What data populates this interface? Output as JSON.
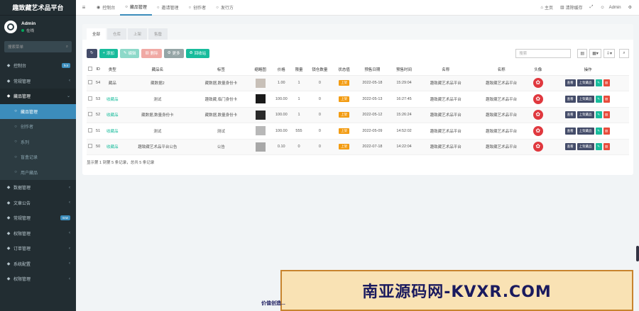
{
  "brand": "趣致藏艺术品平台",
  "user": {
    "name": "Admin",
    "status": "在线"
  },
  "sidebar_search_placeholder": "搜索菜单",
  "sidebar": [
    {
      "label": "控制台",
      "icon": "dashboard-icon",
      "badge": "hot",
      "badge_color": "#3c8dbc"
    },
    {
      "label": "常规管理",
      "icon": "cog-icon",
      "chev": "‹"
    },
    {
      "label": "藏品管理",
      "icon": "cube-icon",
      "chev": "⌄",
      "state": "open"
    },
    {
      "label": "藏品管理",
      "state": "active",
      "sub": true
    },
    {
      "label": "创作者",
      "sub": true
    },
    {
      "label": "系列",
      "sub": true
    },
    {
      "label": "盲盒记录",
      "sub": true
    },
    {
      "label": "用户藏品",
      "sub": true
    },
    {
      "label": "数据管理",
      "icon": "chart-icon",
      "chev": "‹"
    },
    {
      "label": "文章公告",
      "icon": "file-icon",
      "chev": "‹"
    },
    {
      "label": "常规管理",
      "icon": "cog-icon",
      "badge": "new",
      "badge_color": "#3c8dbc"
    },
    {
      "label": "权限管理",
      "icon": "users-icon",
      "chev": "‹"
    },
    {
      "label": "订单管理",
      "icon": "list-icon",
      "chev": "‹"
    },
    {
      "label": "系统配置",
      "icon": "gear-icon",
      "chev": "‹"
    },
    {
      "label": "权限管理",
      "icon": "lock-icon",
      "chev": "‹"
    }
  ],
  "topbar": {
    "tabs": [
      {
        "label": "控制台",
        "icon": "dashboard-icon"
      },
      {
        "label": "藏品管理",
        "icon": "circle-icon",
        "active": true
      },
      {
        "label": "邀请管理",
        "icon": "circle-icon"
      },
      {
        "label": "创作者",
        "icon": "circle-icon"
      },
      {
        "label": "发行方",
        "icon": "circle-icon"
      }
    ],
    "home": "主页",
    "clear_cache": "清除缓存",
    "admin": "Admin"
  },
  "panel_tabs": [
    {
      "label": "全部",
      "active": true
    },
    {
      "label": "仓库"
    },
    {
      "label": "上架"
    },
    {
      "label": "售罄"
    }
  ],
  "toolbar": {
    "add": "添加",
    "edit": "编辑",
    "delete": "删除",
    "more": "更多",
    "airdrop": "回收站",
    "search_placeholder": "搜索"
  },
  "table": {
    "headers": [
      "ID",
      "类型",
      "藏品名",
      "标签",
      "缩略图",
      "价格",
      "限量",
      "锁仓数量",
      "状态值",
      "预售日期",
      "预售时间",
      "名称",
      "名称",
      "头像",
      "操作"
    ],
    "rows": [
      {
        "id": "54",
        "type": "藏品",
        "name": "藏数据2",
        "tag": "藏数据,数量身份卡",
        "thumb_color": "#c8c0b8",
        "price": "1.00",
        "limit": "1",
        "lock": "0",
        "status": "上架",
        "date": "2022-05-18",
        "time": "15:29:04",
        "n1": "趣致藏艺术品平台",
        "n2": "趣致藏艺术品平台"
      },
      {
        "id": "53",
        "type": "收藏品",
        "name": "测试",
        "tag": "趣致藏,临门身份卡",
        "thumb_color": "#1a1a1a",
        "price": "100.00",
        "limit": "1",
        "lock": "0",
        "status": "上架",
        "date": "2022-05-13",
        "time": "16:27:45",
        "n1": "趣致藏艺术品平台",
        "n2": "趣致藏艺术品平台"
      },
      {
        "id": "52",
        "type": "收藏品",
        "name": "藏数据,数量身份卡",
        "tag": "藏数据,数量身份卡",
        "thumb_color": "#2a2a2a",
        "price": "100.00",
        "limit": "1",
        "lock": "0",
        "status": "上架",
        "date": "2022-05-12",
        "time": "15:26:24",
        "n1": "趣致藏艺术品平台",
        "n2": "趣致藏艺术品平台"
      },
      {
        "id": "51",
        "type": "收藏品",
        "name": "测试",
        "tag": "测试",
        "thumb_color": "#b8b8b8",
        "price": "100.00",
        "limit": "555",
        "lock": "0",
        "status": "上架",
        "date": "2022-05-09",
        "time": "14:52:02",
        "n1": "趣致藏艺术品平台",
        "n2": "趣致藏艺术品平台"
      },
      {
        "id": "50",
        "type": "收藏品",
        "name": "趣致藏艺术品平台公告",
        "tag": "公告",
        "thumb_color": "#a8a8a8",
        "price": "0.10",
        "limit": "0",
        "lock": "0",
        "status": "上架",
        "date": "2022-07-18",
        "time": "14:22:04",
        "n1": "趣致藏艺术品平台",
        "n2": "趣致藏艺术品平台"
      }
    ],
    "row_ops": [
      "查看",
      "上架藏品"
    ]
  },
  "footer_info": "显示第 1 到第 5 条记录，总共 5 条记录",
  "watermark": "南亚源码网-KVXR.COM",
  "watermark_small": "价值创造..."
}
